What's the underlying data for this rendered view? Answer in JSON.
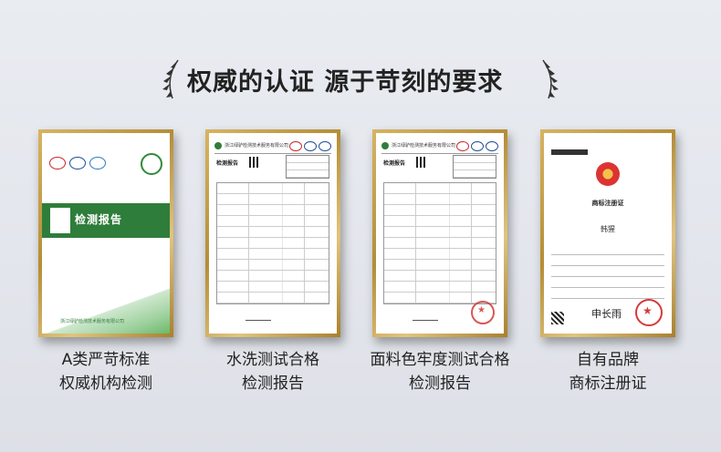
{
  "heading": "权威的认证 源于苛刻的要求",
  "certificates": [
    {
      "caption_line1": "A类严苛标准",
      "caption_line2": "权威机构检测",
      "cover_text": "检测报告",
      "footer_text": "浙江绿驴检测技术服务有限公司"
    },
    {
      "caption_line1": "水洗测试合格",
      "caption_line2": "检测报告",
      "header_text": "浙江绿驴检测技术服务有限公司",
      "report_title": "检测报告"
    },
    {
      "caption_line1": "面料色牢度测试合格",
      "caption_line2": "检测报告",
      "header_text": "浙江绿驴检测技术服务有限公司",
      "report_title": "检测报告"
    },
    {
      "caption_line1": "自有品牌",
      "caption_line2": "商标注册证",
      "cert_title": "商标注册证",
      "mark_text": "韩猩",
      "signature_text": "申长雨"
    }
  ],
  "colors": {
    "frame_gold": "#c9a24b",
    "brand_green": "#2f7d3a",
    "stamp_red": "#d53a3a"
  }
}
